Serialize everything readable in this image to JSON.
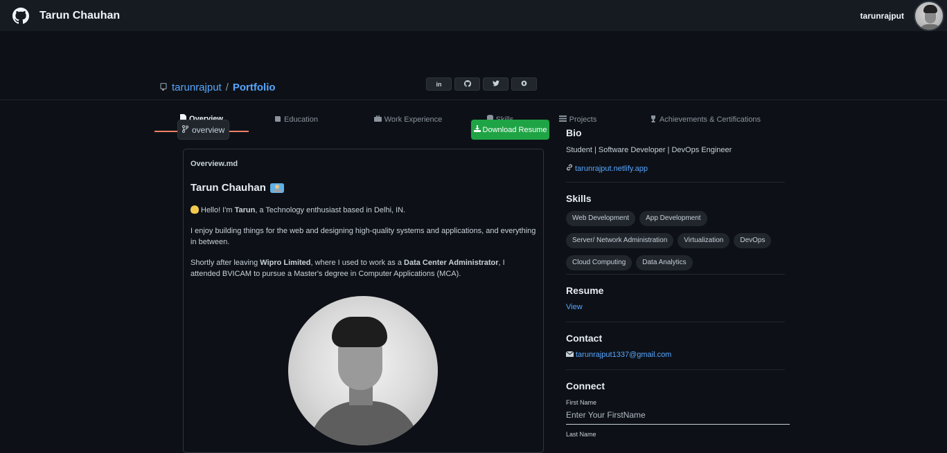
{
  "topbar": {
    "title": "Tarun Chauhan",
    "username": "tarunrajput"
  },
  "repo": {
    "owner": "tarunrajput",
    "separator": "/",
    "name": "Portfolio"
  },
  "social": [
    {
      "label": "in",
      "icon": "linkedin-icon"
    },
    {
      "label": "",
      "icon": "github-icon"
    },
    {
      "label": "",
      "icon": "twitter-icon"
    },
    {
      "label": "",
      "icon": "hackerrank-icon"
    }
  ],
  "tabs": [
    {
      "label": "Overview",
      "icon": "file-icon",
      "active": true
    },
    {
      "label": "Education",
      "icon": "book-icon",
      "active": false
    },
    {
      "label": "Work Experience",
      "icon": "briefcase-icon",
      "active": false
    },
    {
      "label": "Skills",
      "icon": "database-icon",
      "active": false
    },
    {
      "label": "Projects",
      "icon": "list-icon",
      "active": false
    },
    {
      "label": "Achievements & Certifications",
      "icon": "trophy-icon",
      "active": false
    }
  ],
  "main": {
    "branch_label": "overview",
    "download_label": "Download Resume",
    "readme": {
      "filename": "Overview.md",
      "heading": "Tarun Chauhan",
      "p1_pre": "Hello! I'm ",
      "p1_bold": "Tarun",
      "p1_post": ", a Technology enthusiast based in Delhi, IN.",
      "p2": "I enjoy building things for the web and designing high-quality systems and applications, and everything in between.",
      "p3_pre": "Shortly after leaving ",
      "p3_bold1": "Wipro Limited",
      "p3_mid": ", where I used to work as a ",
      "p3_bold2": "Data Center Administrator",
      "p3_post": ", I attended BVICAM to pursue a Master's degree in Computer Applications (MCA)."
    }
  },
  "sidebar": {
    "bio_heading": "Bio",
    "bio_text": "Student | Software Developer | DevOps Engineer",
    "website": "tarunrajput.netlify.app",
    "skills_heading": "Skills",
    "skills": [
      "Web Development",
      "App Development",
      "Server/ Network Administration",
      "Virtualization",
      "DevOps",
      "Cloud Computing",
      "Data Analytics"
    ],
    "resume_heading": "Resume",
    "resume_link": "View",
    "contact_heading": "Contact",
    "email": "tarunrajput1337@gmail.com",
    "connect_heading": "Connect",
    "first_name_label": "First Name",
    "first_name_placeholder": "Enter Your FirstName",
    "last_name_label": "Last Name"
  }
}
